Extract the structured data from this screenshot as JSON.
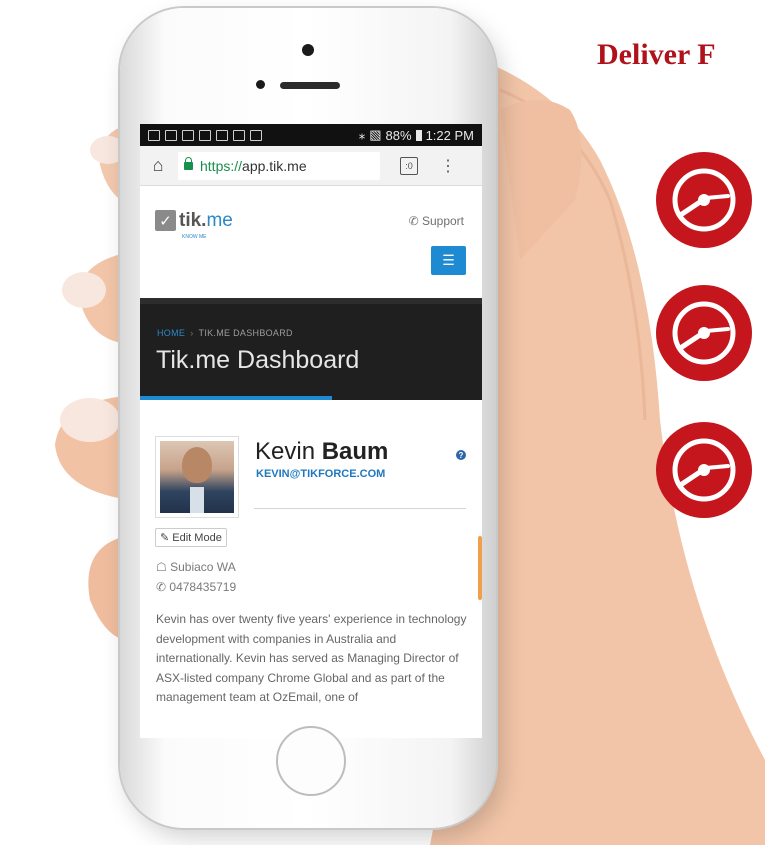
{
  "headline": "Deliver F",
  "colors": {
    "accent_red": "#c4161c",
    "link_blue": "#1e78c0",
    "secure_green": "#16904a"
  },
  "icons": [
    "clock-icon",
    "clock-icon",
    "clock-icon"
  ],
  "statusbar": {
    "battery": "88%",
    "time": "1:22 PM"
  },
  "browser": {
    "url_scheme": "https://",
    "url_host": "app.tik.me",
    "tabs_count": ":0"
  },
  "site": {
    "logo_tik": "tik.",
    "logo_me": "me",
    "logo_sub": "KNOW ME",
    "support": "Support"
  },
  "banner": {
    "crumb_home": "HOME",
    "crumb_current": "TIK.ME DASHBOARD",
    "title": "Tik.me Dashboard"
  },
  "profile": {
    "first_name": "Kevin",
    "last_name": "Baum",
    "email": "KEVIN@TIKFORCE.COM",
    "edit_label": "Edit Mode",
    "location": "Subiaco WA",
    "phone": "0478435719",
    "bio": "Kevin has over twenty five years' experience in technology development with companies in Australia and internationally. Kevin has served as Managing Director of ASX-listed company Chrome Global and as part of the management team at OzEmail, one of"
  }
}
